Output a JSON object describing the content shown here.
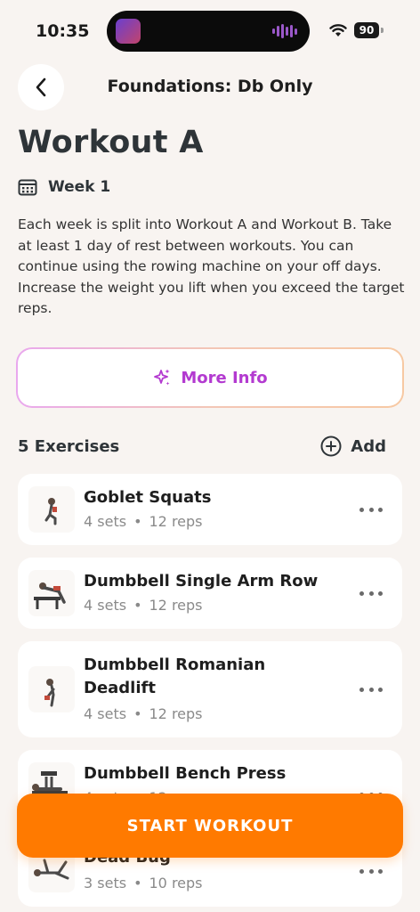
{
  "status_bar": {
    "time": "10:35",
    "battery": "90"
  },
  "header": {
    "title": "Foundations: Db Only"
  },
  "workout": {
    "title": "Workout A",
    "week": "Week 1",
    "description": "Each week is split into Workout A and Workout B. Take at least 1 day of rest between workouts. You can continue using the rowing machine on your off days. Increase the weight you lift when you exceed the target reps."
  },
  "more_info": {
    "label": "More Info"
  },
  "exercises_section": {
    "count_label": "5 Exercises",
    "add_label": "Add"
  },
  "exercises": [
    {
      "name": "Goblet Squats",
      "sets": "4 sets",
      "reps": "12 reps"
    },
    {
      "name": "Dumbbell Single Arm Row",
      "sets": "4 sets",
      "reps": "12 reps"
    },
    {
      "name": "Dumbbell Romanian Deadlift",
      "sets": "4 sets",
      "reps": "12 reps"
    },
    {
      "name": "Dumbbell Bench Press",
      "sets": "4 sets",
      "reps": "12 reps"
    },
    {
      "name": "Dead Bug",
      "sets": "3 sets",
      "reps": "10 reps"
    }
  ],
  "start": {
    "label": "START WORKOUT"
  },
  "colors": {
    "accent": "#ff7a00",
    "more_info_text": "#b33ad0",
    "background": "#f8f4f1"
  }
}
